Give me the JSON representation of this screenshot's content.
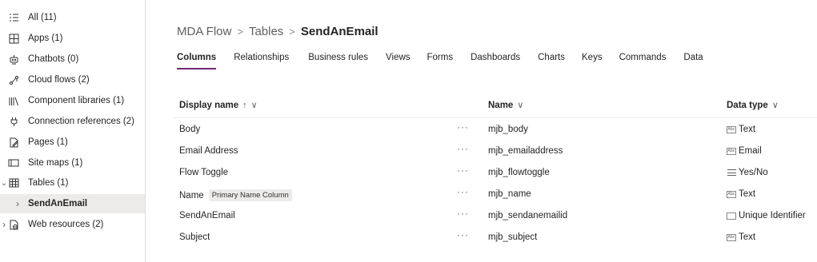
{
  "sidebar": {
    "items": [
      {
        "label": "All (11)",
        "icon": "list-icon"
      },
      {
        "label": "Apps (1)",
        "icon": "apps-icon"
      },
      {
        "label": "Chatbots (0)",
        "icon": "chatbot-icon"
      },
      {
        "label": "Cloud flows (2)",
        "icon": "flow-icon"
      },
      {
        "label": "Component libraries (1)",
        "icon": "library-icon"
      },
      {
        "label": "Connection references (2)",
        "icon": "plug-icon"
      },
      {
        "label": "Pages (1)",
        "icon": "page-icon"
      },
      {
        "label": "Site maps (1)",
        "icon": "sitemap-icon"
      },
      {
        "label": "Tables (1)",
        "icon": "table-icon"
      },
      {
        "label": "SendAnEmail",
        "icon": ""
      },
      {
        "label": "Web resources (2)",
        "icon": "web-resource-icon"
      }
    ]
  },
  "breadcrumb": {
    "parts": [
      "MDA Flow",
      "Tables",
      "SendAnEmail"
    ],
    "separator": ">"
  },
  "tabs": [
    "Columns",
    "Relationships",
    "Business rules",
    "Views",
    "Forms",
    "Dashboards",
    "Charts",
    "Keys",
    "Commands",
    "Data"
  ],
  "table": {
    "headers": {
      "display_name": "Display name",
      "display_sort": "↑",
      "display_chevron": "∨",
      "name": "Name",
      "name_chevron": "∨",
      "data_type": "Data type",
      "data_type_chevron": "∨"
    },
    "more_label": "···",
    "rows": [
      {
        "display": "Body",
        "badge": "",
        "name": "mjb_body",
        "type": "Text",
        "type_icon": "text-type-icon"
      },
      {
        "display": "Email Address",
        "badge": "",
        "name": "mjb_emailaddress",
        "type": "Email",
        "type_icon": "email-type-icon"
      },
      {
        "display": "Flow Toggle",
        "badge": "",
        "name": "mjb_flowtoggle",
        "type": "Yes/No",
        "type_icon": "yes-no-type-icon"
      },
      {
        "display": "Name",
        "badge": "Primary Name Column",
        "name": "mjb_name",
        "type": "Text",
        "type_icon": "text-type-icon"
      },
      {
        "display": "SendAnEmail",
        "badge": "",
        "name": "mjb_sendanemailid",
        "type": "Unique Identifier",
        "type_icon": "unique-id-type-icon"
      },
      {
        "display": "Subject",
        "badge": "",
        "name": "mjb_subject",
        "type": "Text",
        "type_icon": "text-type-icon"
      }
    ]
  },
  "colors": {
    "accent": "#742774",
    "selected_bg": "#edebe9"
  }
}
